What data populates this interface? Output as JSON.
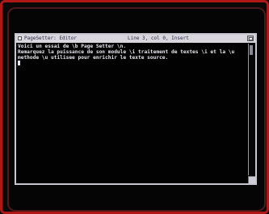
{
  "window": {
    "title": "PageSetter: Editor",
    "status": "Line 3, col 0, Insert"
  },
  "editor": {
    "lines": [
      "Voici un essai de \\b Page Setter \\n.",
      "Remarquez la puissance de son module \\i traitement de textes \\i et la \\u",
      "methode \\u utilisee pour enrichir le texte source."
    ]
  },
  "icons": {
    "close": "close-box-icon",
    "depth": "depth-gadget-icon",
    "size": "size-gadget-icon"
  }
}
